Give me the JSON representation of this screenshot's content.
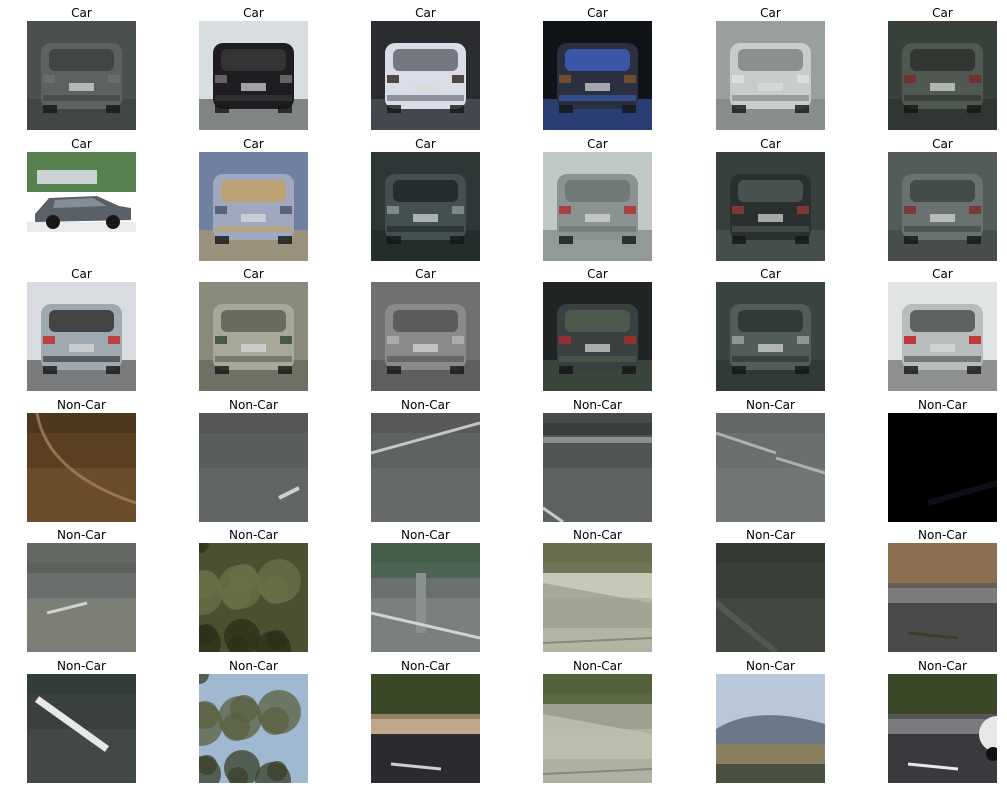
{
  "figure": {
    "tiles": [
      {
        "title": "Car",
        "scene": "car-rear-dark-blurry",
        "palette": [
          "#4a5050",
          "#5c6262",
          "#3a3f3f",
          "#6a7070"
        ]
      },
      {
        "title": "Car",
        "scene": "car-rear-black-street",
        "palette": [
          "#d8dde0",
          "#1e1e22",
          "#3a3a3a",
          "#707070"
        ]
      },
      {
        "title": "Car",
        "scene": "car-rear-headlights-glare",
        "palette": [
          "#2a2c30",
          "#d8dde8",
          "#5a5f66",
          "#3a2a2a"
        ]
      },
      {
        "title": "Car",
        "scene": "car-rear-dark-night",
        "palette": [
          "#101418",
          "#2a3040",
          "#4060c0",
          "#7a5030"
        ]
      },
      {
        "title": "Car",
        "scene": "car-rear-silver-blurry",
        "palette": [
          "#9aa0a0",
          "#c8cccc",
          "#7a7f7f",
          "#e0e2e2"
        ]
      },
      {
        "title": "Car",
        "scene": "car-rear-dark-suv",
        "palette": [
          "#38403a",
          "#505852",
          "#2a302c",
          "#7a2a2a"
        ]
      },
      {
        "title": "Car",
        "scene": "car-side-parking-lot",
        "palette": [
          "#ffffff",
          "#5a6068",
          "#3a6a30",
          "#9098a0"
        ]
      },
      {
        "title": "Car",
        "scene": "car-rear-blurred-colors",
        "palette": [
          "#7080a0",
          "#a0a8c0",
          "#c0a060",
          "#505870"
        ]
      },
      {
        "title": "Car",
        "scene": "car-rear-dark-plate",
        "palette": [
          "#2e3636",
          "#445050",
          "#1e2424",
          "#8a9090"
        ]
      },
      {
        "title": "Car",
        "scene": "car-rear-silver-road",
        "palette": [
          "#c0c8c8",
          "#8a9292",
          "#6a7272",
          "#b03030"
        ]
      },
      {
        "title": "Car",
        "scene": "car-rear-dark-traffic",
        "palette": [
          "#38403e",
          "#2a3030",
          "#505a58",
          "#8a3a30"
        ]
      },
      {
        "title": "Car",
        "scene": "car-rear-grey-hatch",
        "palette": [
          "#545c5a",
          "#6a7270",
          "#3a4240",
          "#7a3030"
        ]
      },
      {
        "title": "Car",
        "scene": "car-rear-silver-bright",
        "palette": [
          "#d8dce0",
          "#a0a8b0",
          "#2a2a2a",
          "#c03030"
        ]
      },
      {
        "title": "Car",
        "scene": "car-rear-beige-minivan",
        "palette": [
          "#8a8a7a",
          "#a8a898",
          "#5a5a50",
          "#3a4a3a"
        ]
      },
      {
        "title": "Car",
        "scene": "car-rear-grey-wagon",
        "palette": [
          "#707070",
          "#8a8a8a",
          "#505050",
          "#b0b0b0"
        ]
      },
      {
        "title": "Car",
        "scene": "car-rear-black-suv",
        "palette": [
          "#202424",
          "#3a4040",
          "#506050",
          "#a03030"
        ]
      },
      {
        "title": "Car",
        "scene": "car-rear-dark-green-van",
        "palette": [
          "#3a4440",
          "#525c58",
          "#2a3230",
          "#9aa0a0"
        ]
      },
      {
        "title": "Car",
        "scene": "car-rear-white-hatch",
        "palette": [
          "#e0e4e4",
          "#b8bcbc",
          "#4a4a4a",
          "#c02020"
        ]
      },
      {
        "title": "Non-Car",
        "scene": "road-curve-brown",
        "palette": [
          "#5a4020",
          "#7a5a30",
          "#3a2a18",
          "#a08060"
        ]
      },
      {
        "title": "Non-Car",
        "scene": "asphalt-grey-marking",
        "palette": [
          "#5a5e5a",
          "#6a6e6a",
          "#4a4e4a",
          "#d0d0d0"
        ]
      },
      {
        "title": "Non-Car",
        "scene": "road-lane-line",
        "palette": [
          "#5e6260",
          "#6e7270",
          "#4a4e4c",
          "#d8d8d8"
        ]
      },
      {
        "title": "Non-Car",
        "scene": "guardrail-road",
        "palette": [
          "#505452",
          "#6a6e6c",
          "#3a3e3c",
          "#c8ccc8"
        ]
      },
      {
        "title": "Non-Car",
        "scene": "asphalt-dashed-lines",
        "palette": [
          "#6a6e6c",
          "#7a7e7c",
          "#5a5e5c",
          "#c0c4c0"
        ]
      },
      {
        "title": "Non-Car",
        "scene": "night-dark-road",
        "palette": [
          "#000000",
          "#080a12",
          "#101420",
          "#1a1e2c"
        ]
      },
      {
        "title": "Non-Car",
        "scene": "road-barrier-dash",
        "palette": [
          "#6a6e6a",
          "#8a8e80",
          "#5a5e5a",
          "#d0d0d0"
        ]
      },
      {
        "title": "Non-Car",
        "scene": "trees-foliage",
        "palette": [
          "#4a5030",
          "#6a7048",
          "#2a3018",
          "#8a8a60"
        ]
      },
      {
        "title": "Non-Car",
        "scene": "road-post-barrier",
        "palette": [
          "#6a7070",
          "#8a9090",
          "#3a5a40",
          "#d0d4d0"
        ]
      },
      {
        "title": "Non-Car",
        "scene": "concrete-barrier-bright",
        "palette": [
          "#c8c8b8",
          "#a0a090",
          "#5a6040",
          "#6a6e6a"
        ]
      },
      {
        "title": "Non-Car",
        "scene": "blurry-dark-road",
        "palette": [
          "#3a4038",
          "#4a5048",
          "#2a3028",
          "#6a7068"
        ]
      },
      {
        "title": "Non-Car",
        "scene": "road-trees-dry",
        "palette": [
          "#4a4a4a",
          "#5a5a5a",
          "#8a7050",
          "#3a4028"
        ]
      },
      {
        "title": "Non-Car",
        "scene": "asphalt-diagonal-line",
        "palette": [
          "#3a4040",
          "#4a5050",
          "#2e3434",
          "#e8e8e8"
        ]
      },
      {
        "title": "Non-Car",
        "scene": "tree-branches-sky",
        "palette": [
          "#a0b8d0",
          "#5a6040",
          "#3a4028",
          "#c0d0e0"
        ]
      },
      {
        "title": "Non-Car",
        "scene": "road-dry-field-trees",
        "palette": [
          "#2a2a30",
          "#b09070",
          "#3a4828",
          "#d0d0d0"
        ]
      },
      {
        "title": "Non-Car",
        "scene": "concrete-barrier-trees",
        "palette": [
          "#a0a090",
          "#c0c0b0",
          "#4a5a30",
          "#6a6e6a"
        ]
      },
      {
        "title": "Non-Car",
        "scene": "hills-sky-landscape",
        "palette": [
          "#b8c8d8",
          "#6a7888",
          "#8a8060",
          "#4a5040"
        ]
      },
      {
        "title": "Non-Car",
        "scene": "road-trees-car-edge",
        "palette": [
          "#3a3a3e",
          "#5a5a5e",
          "#3a4828",
          "#e8e8e8"
        ]
      }
    ]
  }
}
